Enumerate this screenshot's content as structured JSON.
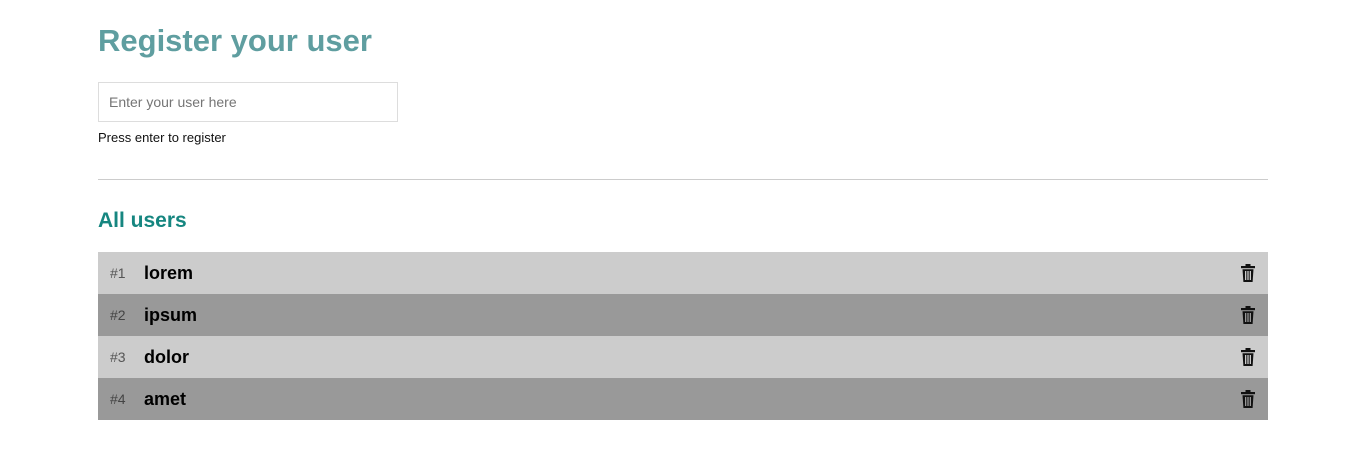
{
  "header": {
    "title": "Register your user"
  },
  "form": {
    "input_placeholder": "Enter your user here",
    "input_value": "",
    "hint": "Press enter to register"
  },
  "list": {
    "title": "All users",
    "delete_icon": "trash-icon",
    "users": [
      {
        "index": "#1",
        "name": "lorem"
      },
      {
        "index": "#2",
        "name": "ipsum"
      },
      {
        "index": "#3",
        "name": "dolor"
      },
      {
        "index": "#4",
        "name": "amet"
      }
    ]
  },
  "colors": {
    "title": "#5f9ea0",
    "section_title": "#168680",
    "row_light": "#cccccc",
    "row_dark": "#999999"
  }
}
